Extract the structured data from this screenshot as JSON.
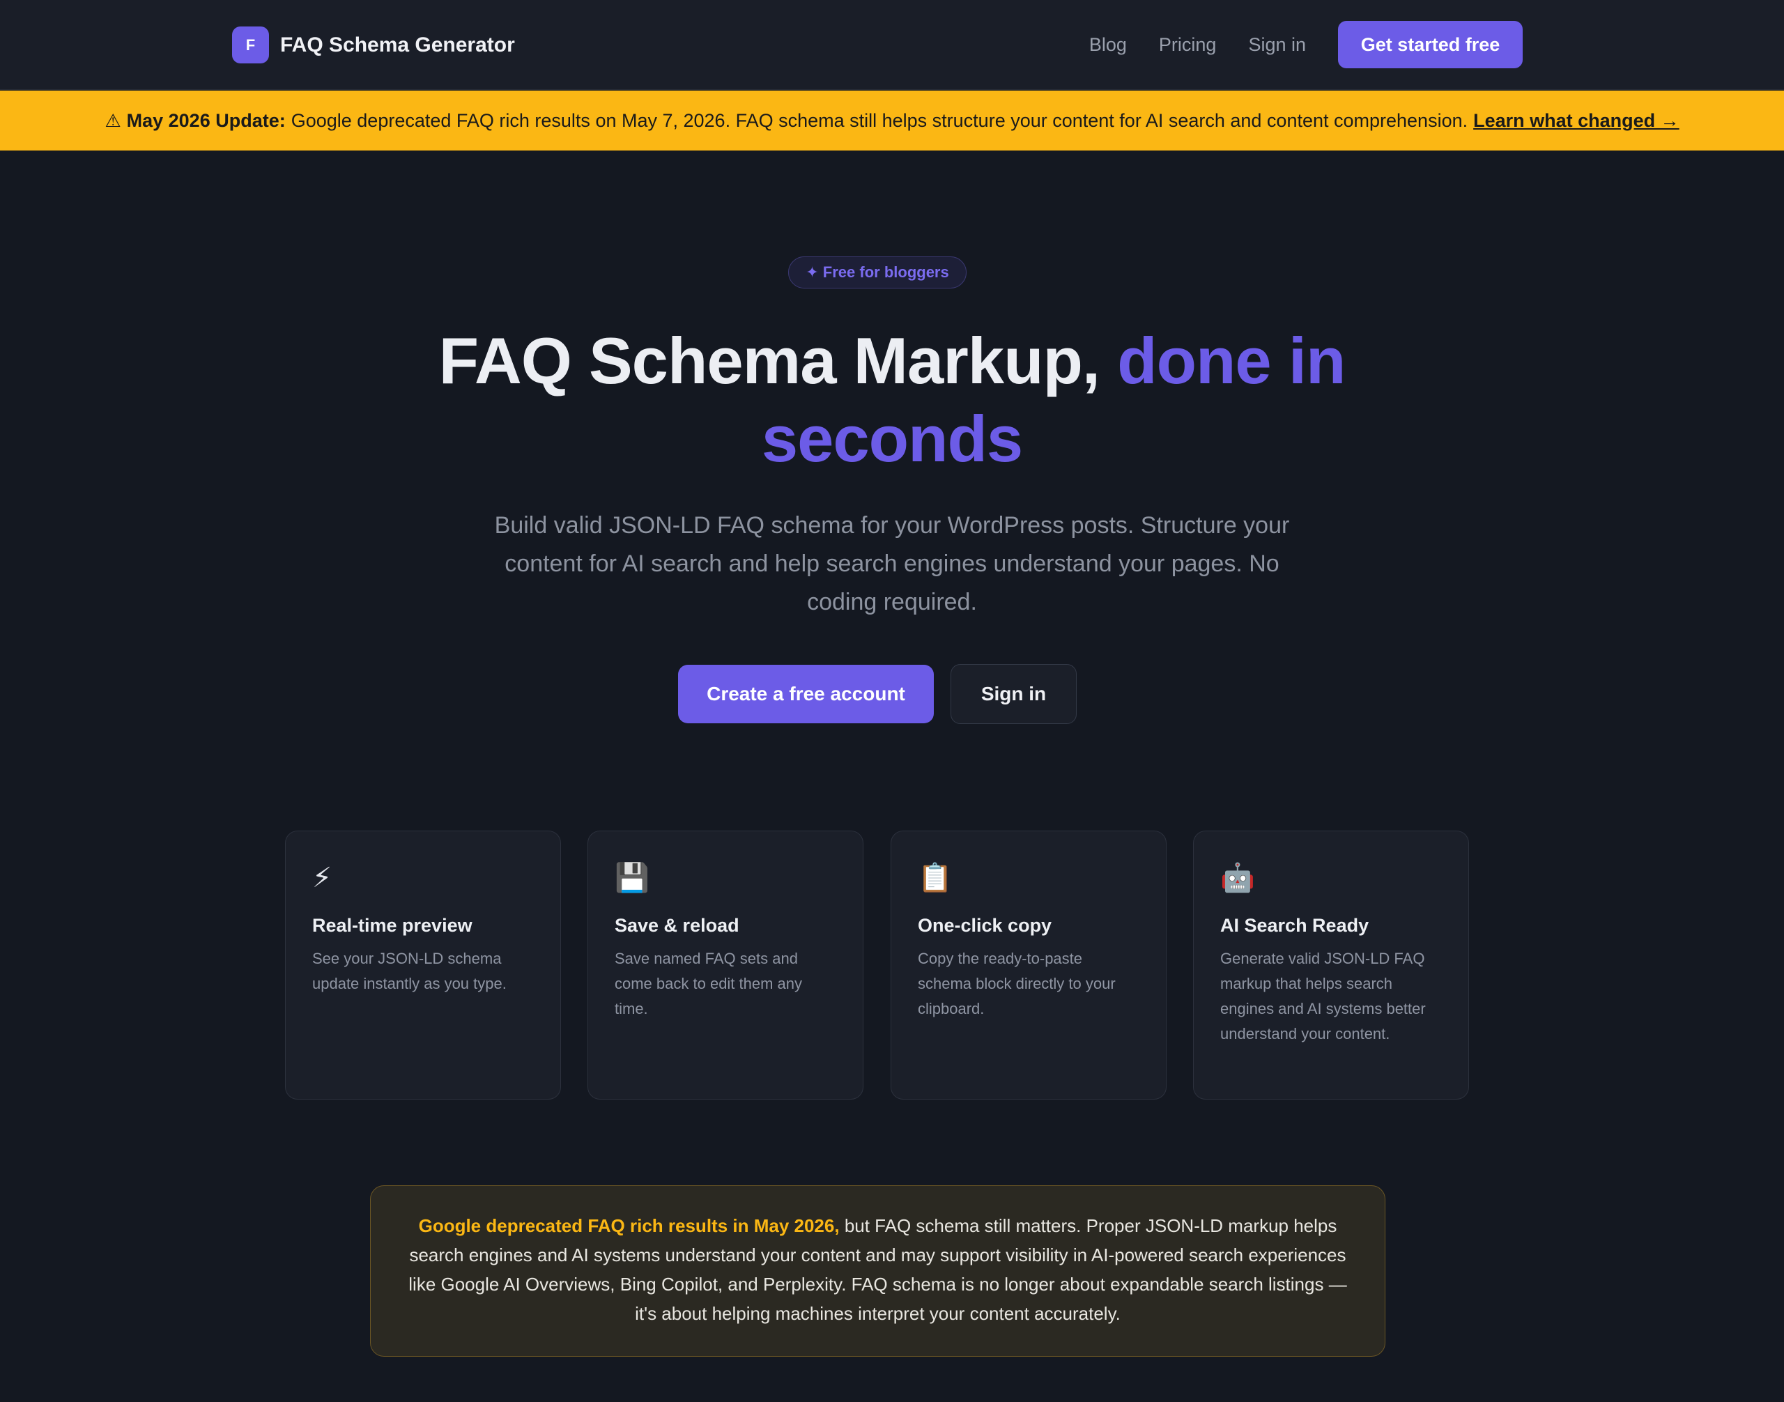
{
  "header": {
    "logo_letter": "F",
    "brand": "FAQ Schema Generator",
    "nav": {
      "blog": "Blog",
      "pricing": "Pricing",
      "sign_in": "Sign in",
      "cta": "Get started free"
    }
  },
  "banner": {
    "icon": "⚠",
    "label": "May 2026 Update:",
    "text": "Google deprecated FAQ rich results on May 7, 2026. FAQ schema still helps structure your content for AI search and content comprehension.",
    "link": "Learn what changed →",
    "color": "#fbb714"
  },
  "hero": {
    "pill": "✦ Free for bloggers",
    "title_main": "FAQ Schema Markup,",
    "title_accent": "done in seconds",
    "subtitle": "Build valid JSON-LD FAQ schema for your WordPress posts. Structure your content for AI search and help search engines understand your pages. No coding required.",
    "primary_button": "Create a free account",
    "secondary_button": "Sign in",
    "accent_color": "#6c5ce7"
  },
  "features": [
    {
      "icon": "⚡",
      "icon_name": "lightning-icon",
      "title": "Real-time preview",
      "desc": "See your JSON-LD schema update instantly as you type."
    },
    {
      "icon": "💾",
      "icon_name": "floppy-disk-icon",
      "title": "Save & reload",
      "desc": "Save named FAQ sets and come back to edit them any time."
    },
    {
      "icon": "📋",
      "icon_name": "clipboard-icon",
      "title": "One-click copy",
      "desc": "Copy the ready-to-paste schema block directly to your clipboard."
    },
    {
      "icon": "🤖",
      "icon_name": "robot-icon",
      "title": "AI Search Ready",
      "desc": "Generate valid JSON-LD FAQ markup that helps search engines and AI systems better understand your content."
    }
  ],
  "notice": {
    "highlight": "Google deprecated FAQ rich results in May 2026,",
    "text": "but FAQ schema still matters. Proper JSON-LD markup helps search engines and AI systems understand your content and may support visibility in AI-powered search experiences like Google AI Overviews, Bing Copilot, and Perplexity. FAQ schema is no longer about expandable search listings — it's about helping machines interpret your content accurately."
  }
}
